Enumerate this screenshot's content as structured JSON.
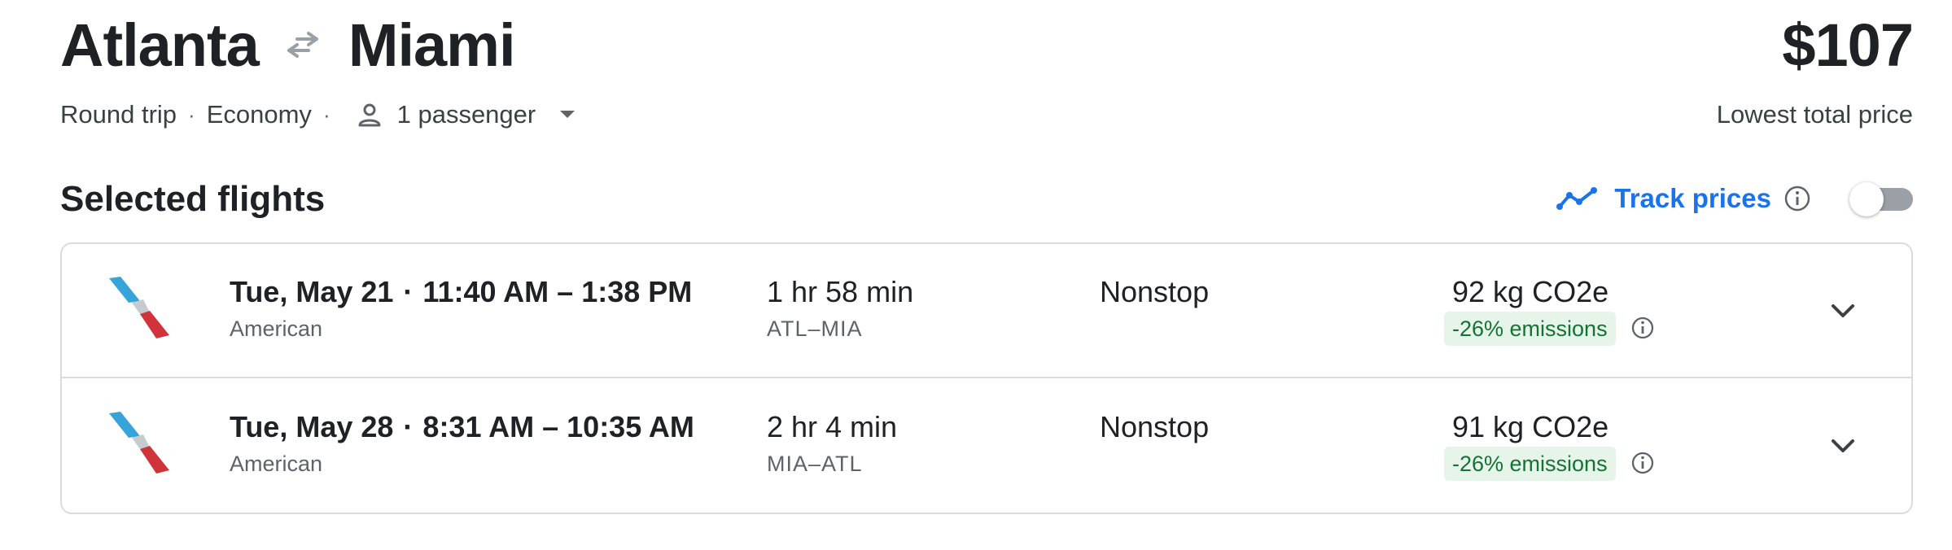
{
  "header": {
    "origin": "Atlanta",
    "destination": "Miami",
    "swap_icon": "swap-arrows-icon",
    "price": "$107",
    "price_caption": "Lowest total price",
    "trip_type": "Round trip",
    "cabin_class": "Economy",
    "passenger_icon": "person-icon",
    "passengers": "1 passenger",
    "separator": "·"
  },
  "section": {
    "title": "Selected flights",
    "track_prices_label": "Track prices",
    "track_prices_enabled": false
  },
  "flights": [
    {
      "date": "Tue, May 21",
      "time_range": "11:40 AM – 1:38 PM",
      "airline": "American",
      "duration": "1 hr 58 min",
      "airports": "ATL–MIA",
      "stops": "Nonstop",
      "emissions": "92 kg CO2e",
      "emissions_badge": "-26% emissions"
    },
    {
      "date": "Tue, May 28",
      "time_range": "8:31 AM – 10:35 AM",
      "airline": "American",
      "duration": "2 hr 4 min",
      "airports": "MIA–ATL",
      "stops": "Nonstop",
      "emissions": "91 kg CO2e",
      "emissions_badge": "-26% emissions"
    }
  ],
  "colors": {
    "accent_blue": "#1a73e8",
    "text_primary": "#202124",
    "text_secondary": "#5f6368",
    "emissions_bg": "#e6f4ea",
    "emissions_text": "#137333",
    "border": "#dadce0",
    "logo_blue": "#36a3d9",
    "logo_red": "#d0343a",
    "logo_gray": "#c6cbd0"
  }
}
